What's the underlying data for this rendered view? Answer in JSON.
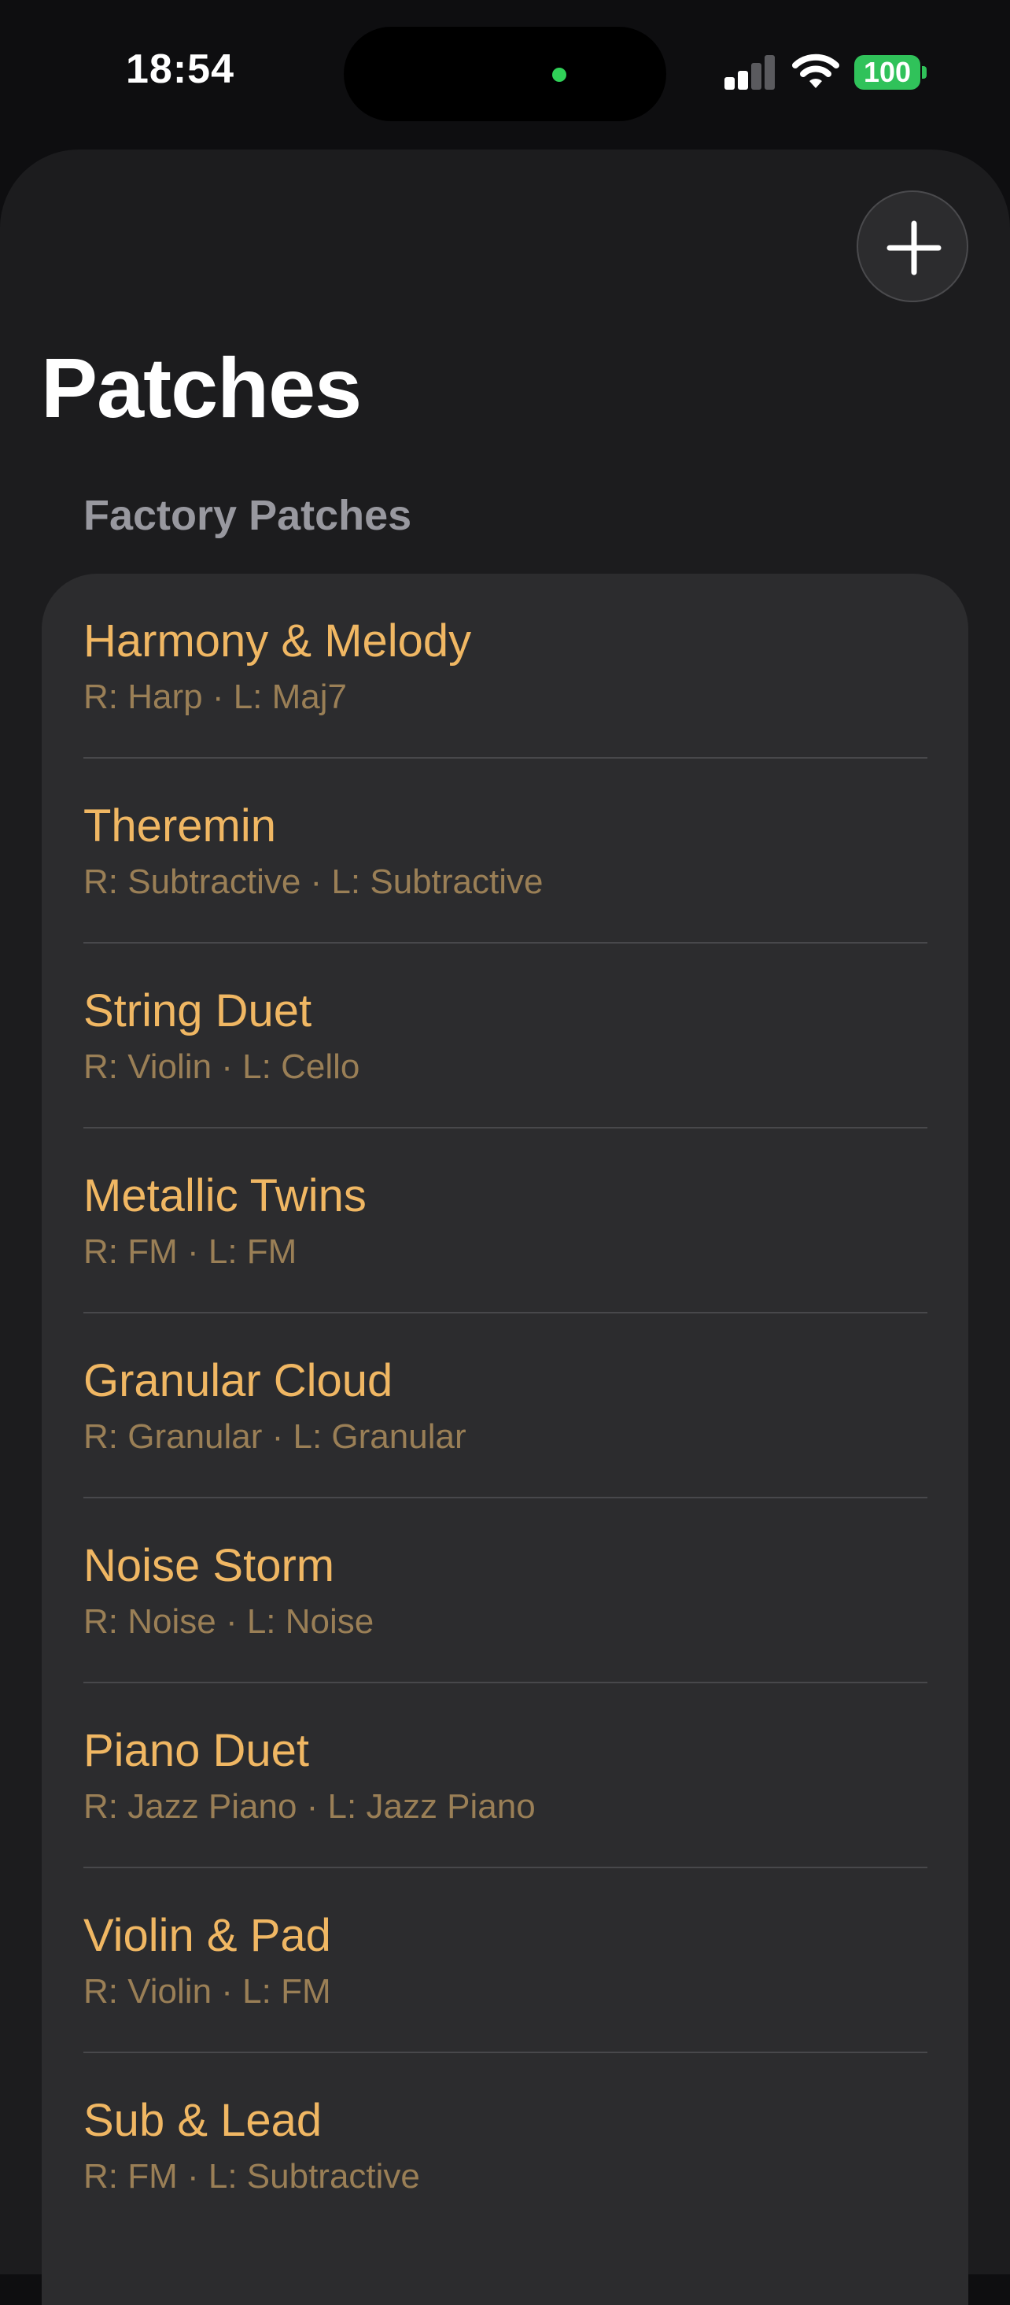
{
  "status_bar": {
    "time": "18:54",
    "battery": "100",
    "colors": {
      "signal_active": "#ffffff",
      "signal_inactive": "#5a5a5e",
      "battery_fill": "#30c25a",
      "privacy_dot": "#30d158"
    },
    "icons": [
      "cellular-signal-icon",
      "wifi-icon",
      "battery-icon"
    ]
  },
  "header": {
    "title": "Patches",
    "add_icon": "plus-icon"
  },
  "section": {
    "title": "Factory Patches"
  },
  "patches": [
    {
      "name": "Harmony & Melody",
      "detail": "R: Harp · L: Maj7"
    },
    {
      "name": "Theremin",
      "detail": "R: Subtractive · L: Subtractive"
    },
    {
      "name": "String Duet",
      "detail": "R: Violin · L: Cello"
    },
    {
      "name": "Metallic Twins",
      "detail": "R: FM · L: FM"
    },
    {
      "name": "Granular Cloud",
      "detail": "R: Granular · L: Granular"
    },
    {
      "name": "Noise Storm",
      "detail": "R: Noise · L: Noise"
    },
    {
      "name": "Piano Duet",
      "detail": "R: Jazz Piano · L: Jazz Piano"
    },
    {
      "name": "Violin & Pad",
      "detail": "R: Violin · L: FM"
    },
    {
      "name": "Sub & Lead",
      "detail": "R: FM · L: Subtractive"
    }
  ],
  "colors": {
    "accent": "#f0b763",
    "accent_secondary": "#9a7f56",
    "background": "#0e0e10",
    "sheet": "#1c1c1e",
    "card": "#2c2c2e"
  }
}
